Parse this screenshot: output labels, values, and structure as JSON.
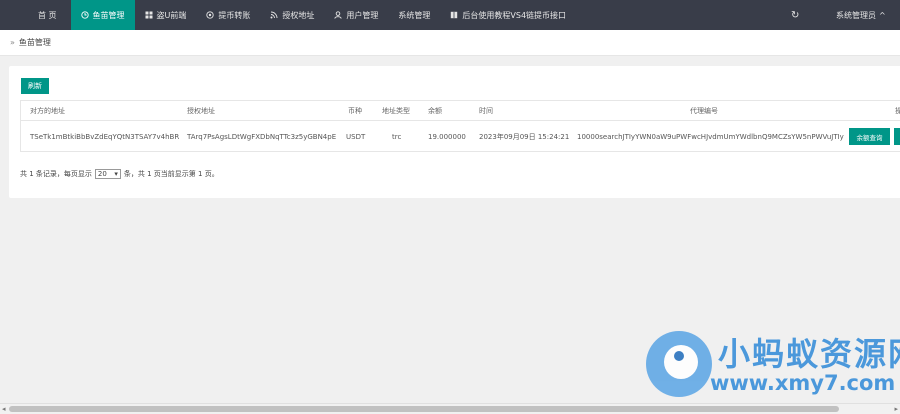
{
  "nav": {
    "items": [
      {
        "label": "首 页",
        "icon": ""
      },
      {
        "label": "鱼苗管理",
        "icon": "clock-icon"
      },
      {
        "label": "盗U前端",
        "icon": "windows-icon"
      },
      {
        "label": "提币转账",
        "icon": "coin-icon"
      },
      {
        "label": "授权地址",
        "icon": "rss-icon"
      },
      {
        "label": "用户管理",
        "icon": "user-icon"
      },
      {
        "label": "系统管理",
        "icon": ""
      },
      {
        "label": "后台使用教程VS4链提币接口",
        "icon": "book-icon"
      }
    ],
    "active_index": 1,
    "refresh_glyph": "↻",
    "admin_label": "系统管理员",
    "admin_caret": "^"
  },
  "breadcrumb": {
    "separator": "»",
    "current": "鱼苗管理"
  },
  "toolbar": {
    "refresh_label": "刷新"
  },
  "table": {
    "columns": [
      "对方的地址",
      "授权地址",
      "币种",
      "地址类型",
      "余额",
      "时间",
      "代理编号",
      "操"
    ],
    "rows": [
      {
        "cells": [
          "TSeTk1mBtkiBbBvZdEqYQtN3TSAY7v4hBR",
          "TArq7PsAgsLDtWgFXDbNqTTc3z5yGBN4pE",
          "USDT",
          "trc",
          "19.000000",
          "2023年09月09日 15:24:21",
          "10000searchJTIyYWN0aW9uPWFwcHJvdmUmYWdlbnQ9MCZsYW5nPWVuJTIy"
        ],
        "action_label": "余额查询"
      }
    ]
  },
  "pager": {
    "text_before": "共 1 条记录，每页显示",
    "page_size": "20",
    "text_after": "条，共 1 页当前显示第 1 页。"
  },
  "scrollbar": {
    "left_arrow": "◂",
    "right_arrow": "▸"
  },
  "watermark": {
    "title": "小蚂蚁资源网",
    "url": "www.xmy7.com"
  },
  "colors": {
    "nav_bg": "#393d49",
    "accent": "#009688",
    "page_bg": "#f0f0f0",
    "watermark": "#4b98db"
  }
}
